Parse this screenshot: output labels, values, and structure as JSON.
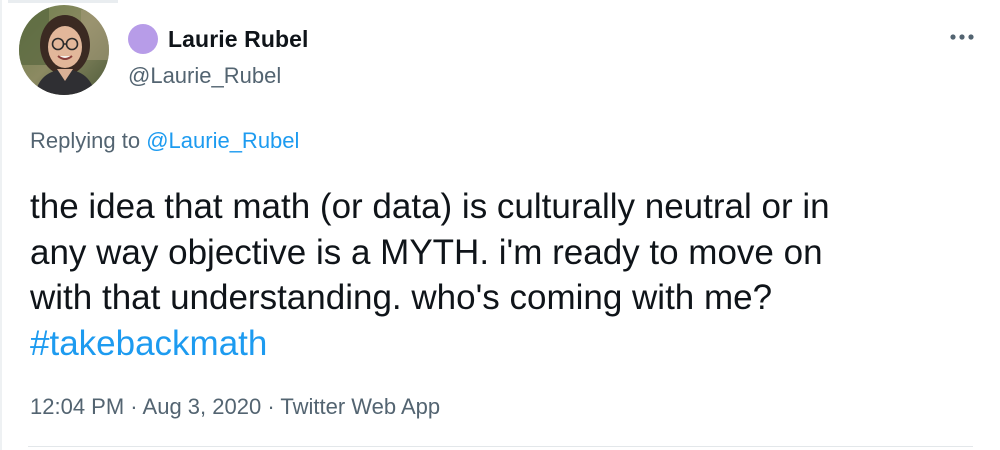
{
  "author": {
    "display_name": "Laurie Rubel",
    "handle": "@Laurie_Rubel",
    "emoji_color": "#b79ce8"
  },
  "reply": {
    "prefix": "Replying to",
    "mention": "@Laurie_Rubel"
  },
  "tweet": {
    "lines": [
      "the idea that math (or data) is culturally neutral or in",
      "any way objective is a MYTH. i'm ready to move on",
      "with that understanding. who's coming with me?"
    ],
    "hashtag": "#takebackmath"
  },
  "meta": {
    "time": "12:04 PM",
    "separator": "·",
    "date": "Aug 3, 2020",
    "source": "Twitter Web App"
  },
  "icons": {
    "more": "more-horizontal-icon",
    "avatar": "profile-photo"
  },
  "colors": {
    "link": "#1d9bf0",
    "secondary_text": "#536471",
    "primary_text": "#0f1419"
  }
}
